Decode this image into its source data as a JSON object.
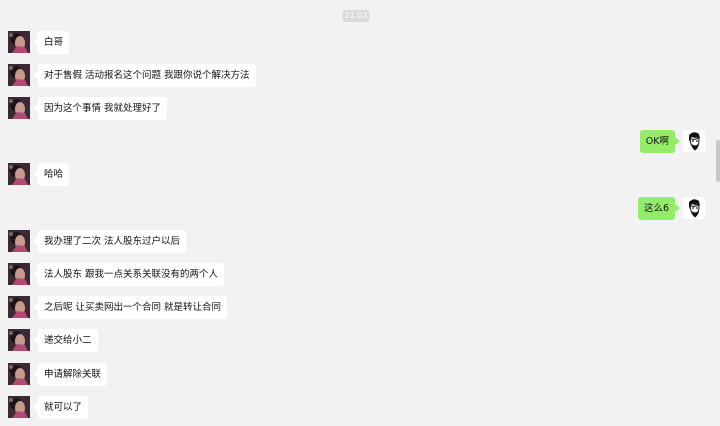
{
  "timestamp": "21:03",
  "messages": [
    {
      "side": "left",
      "text": "白哥"
    },
    {
      "side": "left",
      "text": "对于售假 活动报名这个问题 我跟你说个解决方法"
    },
    {
      "side": "left",
      "text": "因为这个事情 我就处理好了"
    },
    {
      "side": "right",
      "text": "OK啊"
    },
    {
      "side": "left",
      "text": "哈哈"
    },
    {
      "side": "right",
      "text": "这么6"
    },
    {
      "side": "left",
      "text": "我办理了二次 法人股东过户以后"
    },
    {
      "side": "left",
      "text": "法人股东 跟我一点关系关联没有的两个人"
    },
    {
      "side": "left",
      "text": "之后呢 让买卖网出一个合同 就是转让合同"
    },
    {
      "side": "left",
      "text": "递交给小二"
    },
    {
      "side": "left",
      "text": "申请解除关联"
    },
    {
      "side": "left",
      "text": "就可以了"
    }
  ],
  "colors": {
    "background": "#f2f2f2",
    "bubble_incoming": "#ffffff",
    "bubble_outgoing": "#95ec69"
  },
  "icons": {
    "incoming_avatar": "contact-avatar-icon",
    "outgoing_avatar": "self-avatar-icon"
  }
}
